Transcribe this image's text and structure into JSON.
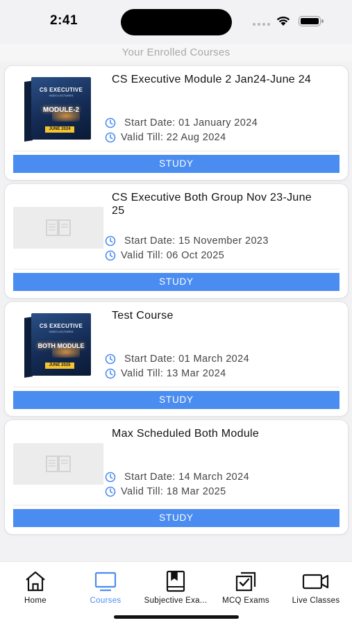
{
  "status_bar": {
    "time": "2:41"
  },
  "header": {
    "title": "Your Enrolled Courses"
  },
  "courses": [
    {
      "title": "CS Executive Module 2 Jan24-June 24",
      "start_date": "Start Date: 01 January 2024",
      "valid_till": "Valid Till: 22 Aug 2024",
      "button_label": "STUDY",
      "thumbnail": "box-art-module-2",
      "box_heading": "CS EXECUTIVE",
      "box_subheading": "VIDEO LECTURES",
      "box_module": "MODULE-2",
      "box_tag": "JUNE 2024"
    },
    {
      "title": "CS Executive Both Group Nov 23-June 25",
      "start_date": "Start Date: 15 November 2023",
      "valid_till": "Valid Till: 06 Oct 2025",
      "button_label": "STUDY",
      "thumbnail": "placeholder-book-icon"
    },
    {
      "title": "Test Course",
      "start_date": "Start Date: 01 March 2024",
      "valid_till": "Valid Till: 13 Mar 2024",
      "button_label": "STUDY",
      "thumbnail": "box-art-both-module",
      "box_heading": "CS EXECUTIVE",
      "box_subheading": "VIDEO LECTURES",
      "box_module": "BOTH MODULE",
      "box_tag": "JUNE 2025"
    },
    {
      "title": "Max Scheduled Both Module",
      "start_date": "Start Date: 14 March 2024",
      "valid_till": "Valid Till: 18 Mar 2025",
      "button_label": "STUDY",
      "thumbnail": "placeholder-book-icon"
    }
  ],
  "bottom_nav": [
    {
      "label": "Home",
      "icon": "home-icon",
      "active": false
    },
    {
      "label": "Courses",
      "icon": "monitor-icon",
      "active": true
    },
    {
      "label": "Subjective Exa...",
      "icon": "book-icon",
      "active": false
    },
    {
      "label": "MCQ Exams",
      "icon": "checklist-icon",
      "active": false
    },
    {
      "label": "Live Classes",
      "icon": "video-camera-icon",
      "active": false
    }
  ],
  "colors": {
    "accent": "#4a8cf0",
    "icon_blue": "#4a8cf0",
    "background": "#f2f2f4"
  }
}
